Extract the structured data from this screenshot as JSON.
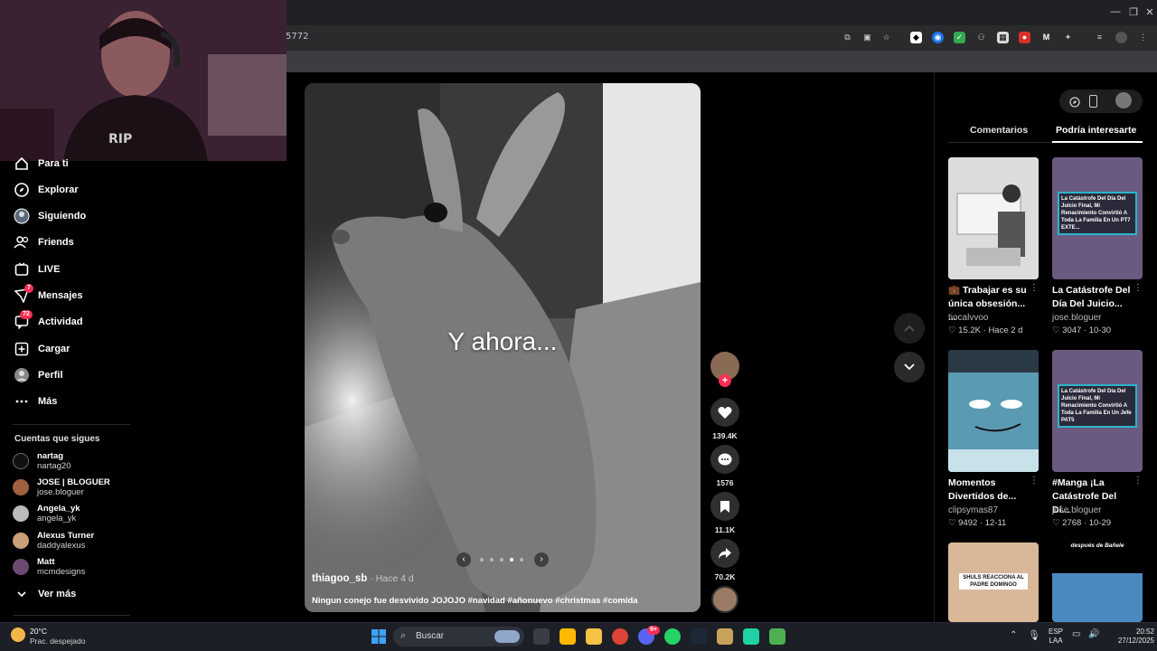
{
  "browser": {
    "url_fragment": "5772"
  },
  "sidebar": {
    "items": [
      {
        "label": "Para ti",
        "icon": "home-icon"
      },
      {
        "label": "Explorar",
        "icon": "compass-icon"
      },
      {
        "label": "Siguiendo",
        "icon": "following-icon"
      },
      {
        "label": "Friends",
        "icon": "friends-icon"
      },
      {
        "label": "LIVE",
        "icon": "live-icon"
      },
      {
        "label": "Mensajes",
        "icon": "messages-icon",
        "badge": "7"
      },
      {
        "label": "Actividad",
        "icon": "activity-icon",
        "badge": "72"
      },
      {
        "label": "Cargar",
        "icon": "upload-icon"
      },
      {
        "label": "Perfil",
        "icon": "profile-icon"
      },
      {
        "label": "Más",
        "icon": "more-icon"
      }
    ],
    "following_label": "Cuentas que sigues",
    "following": [
      {
        "name": "nartag",
        "handle": "nartag20"
      },
      {
        "name": "JOSE | BLOGUER",
        "handle": "jose.bloguer"
      },
      {
        "name": "Angela_yk",
        "handle": "angela_yk"
      },
      {
        "name": "Alexus Turner",
        "handle": "daddyalexus"
      },
      {
        "name": "Matt",
        "handle": "mcmdesigns"
      }
    ],
    "see_more": "Ver más"
  },
  "video": {
    "overlay_text": "Y ahora...",
    "author": "thiagoo_sb",
    "time": " · Hace 4 d",
    "description": "Ningun conejo fue desvivido JOJOJO #navidad #añonuevo #christmas #comida",
    "carousel_dots": 5,
    "carousel_active": 3
  },
  "actions": {
    "likes": "139.4K",
    "comments": "1576",
    "saves": "11.1K",
    "shares": "70.2K"
  },
  "panel": {
    "tabs": [
      "Comentarios",
      "Podría interesarte"
    ],
    "active_tab": 1,
    "cards": [
      {
        "title": "💼 Trabajar es su única obsesión... ...",
        "user": "tiocalvvoo",
        "likes": "15.2K",
        "date": "Hace 2 d",
        "thumb_text": ""
      },
      {
        "title": "La Catástrofe Del Día Del Juicio...",
        "user": "jose.bloguer",
        "likes": "3047",
        "date": "10-30",
        "thumb_text": "La Catástrofe Del Día Del Juicio Final, Mi Renacimiento Convirtió A Toda La Familia En Un PT7 EXTE..."
      },
      {
        "title": "Momentos Divertidos de...",
        "user": "clipsymas87",
        "likes": "9492",
        "date": "12-11",
        "thumb_text": ""
      },
      {
        "title": "#Manga ¡La Catástrofe Del Dí...",
        "user": "jose.bloguer",
        "likes": "2768",
        "date": "10-29",
        "thumb_text": "La Catástrofe Del Día Del Juicio Final, Mi Renacimiento Convirtió A Toda La Familia En Un Jefe PAT5"
      },
      {
        "title": "",
        "user": "",
        "likes": "",
        "date": "",
        "thumb_text": "SHULS REACCIONA AL PADRE DOMINGO"
      },
      {
        "title": "",
        "user": "",
        "likes": "",
        "date": "",
        "thumb_text": "después de Bañele"
      }
    ]
  },
  "taskbar": {
    "weather_temp": "20°C",
    "weather_desc": "Prac. despejado",
    "search_placeholder": "Buscar",
    "lang": "ESP",
    "lang2": "LAA",
    "time": "20:52",
    "date": "27/12/2025",
    "discord_badge": "9+"
  },
  "colors": {
    "accent": "#fe2c55",
    "bg": "#000000"
  }
}
